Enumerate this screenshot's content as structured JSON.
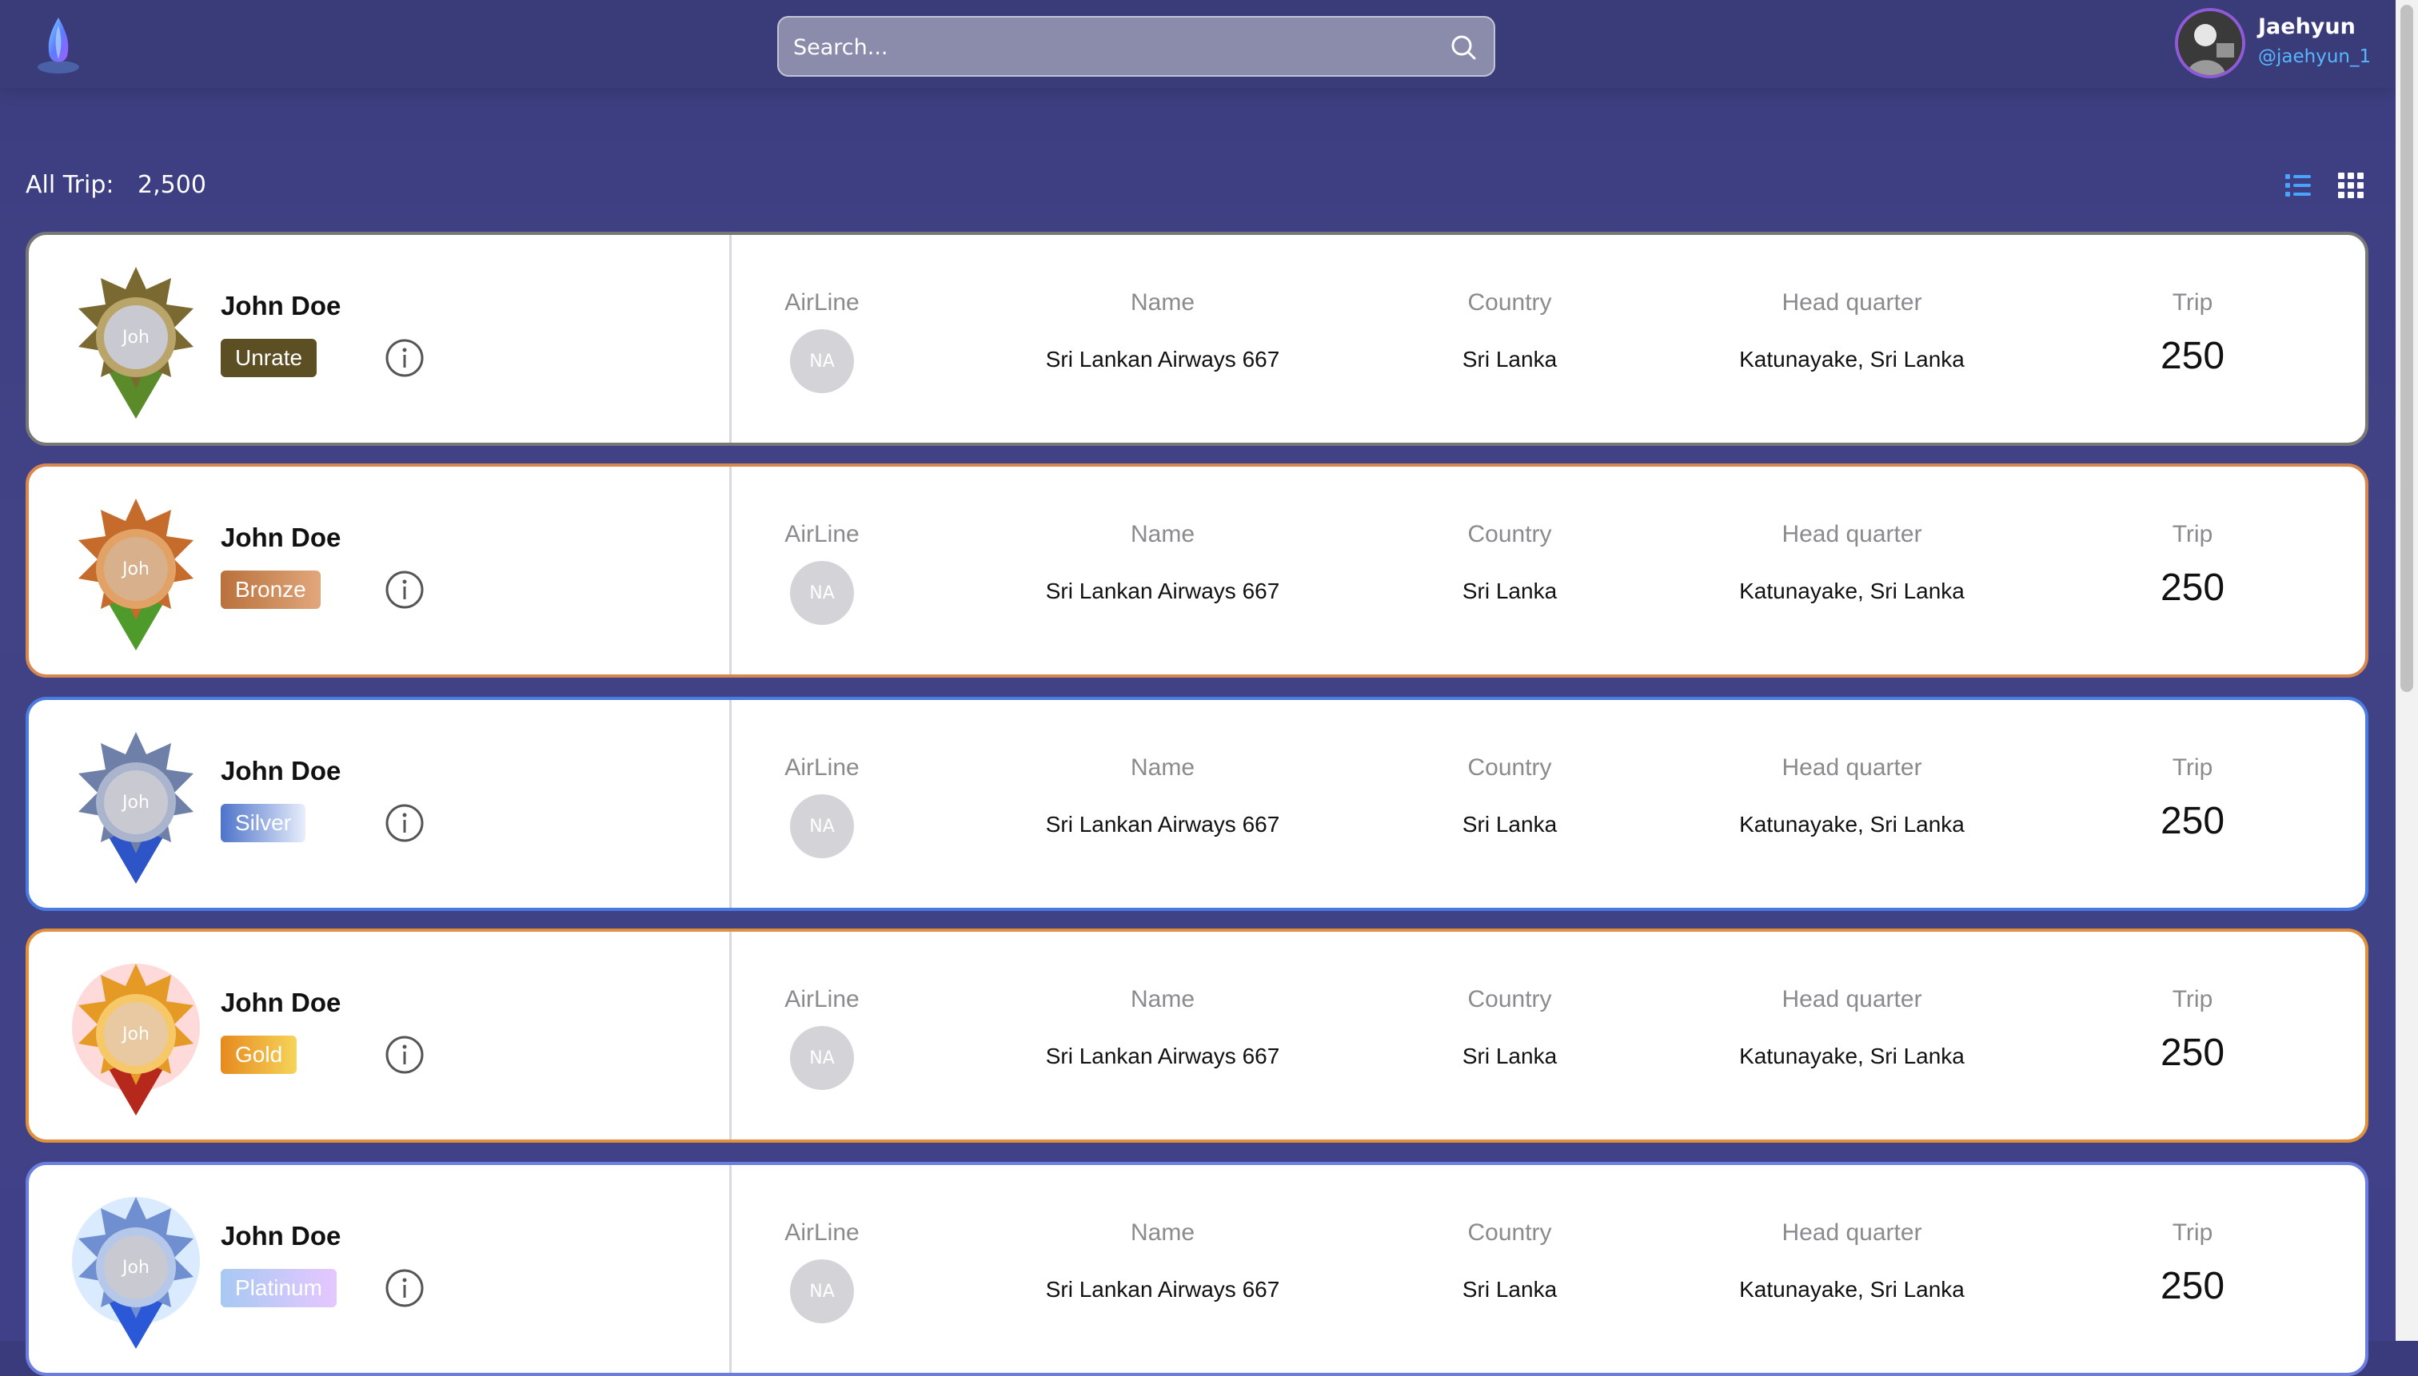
{
  "header": {
    "search_placeholder": "Search...",
    "user": {
      "name": "Jaehyun",
      "handle": "@jaehyun_1"
    }
  },
  "summary": {
    "label": "All Trip:",
    "count": "2,500"
  },
  "view_toggle": {
    "list_icon": "list-view-icon",
    "grid_icon": "grid-view-icon"
  },
  "columns": {
    "airline": "AirLine",
    "name": "Name",
    "country": "Country",
    "hq": "Head quarter",
    "trip": "Trip"
  },
  "rows": [
    {
      "person": "John Doe",
      "avatar_text": "Joh",
      "tier": "Unrate",
      "tier_color": "#5b4f23",
      "border": "#6e6a52",
      "airline_initials": "NA",
      "airline_name": "Sri Lankan Airways 667",
      "country": "Sri Lanka",
      "hq": "Katunayake, Sri Lanka",
      "trip": "250"
    },
    {
      "person": "John Doe",
      "avatar_text": "Joh",
      "tier": "Bronze",
      "tier_color": "#b9713c",
      "border": "#d8884f",
      "airline_initials": "NA",
      "airline_name": "Sri Lankan Airways 667",
      "country": "Sri Lanka",
      "hq": "Katunayake, Sri Lanka",
      "trip": "250"
    },
    {
      "person": "John Doe",
      "avatar_text": "Joh",
      "tier": "Silver",
      "tier_color": "#4d73c9",
      "border": "#4a7be0",
      "airline_initials": "NA",
      "airline_name": "Sri Lankan Airways 667",
      "country": "Sri Lanka",
      "hq": "Katunayake, Sri Lanka",
      "trip": "250"
    },
    {
      "person": "John Doe",
      "avatar_text": "Joh",
      "tier": "Gold",
      "tier_color": "#e89b2a",
      "border": "#e0903a",
      "airline_initials": "NA",
      "airline_name": "Sri Lankan Airways 667",
      "country": "Sri Lanka",
      "hq": "Katunayake, Sri Lanka",
      "trip": "250"
    },
    {
      "person": "John Doe",
      "avatar_text": "Joh",
      "tier": "Platinum",
      "tier_color": "#a7c9f2",
      "border": "#6b7ee0",
      "airline_initials": "NA",
      "airline_name": "Sri Lankan Airways 667",
      "country": "Sri Lanka",
      "hq": "Katunayake, Sri Lanka",
      "trip": "250"
    }
  ]
}
